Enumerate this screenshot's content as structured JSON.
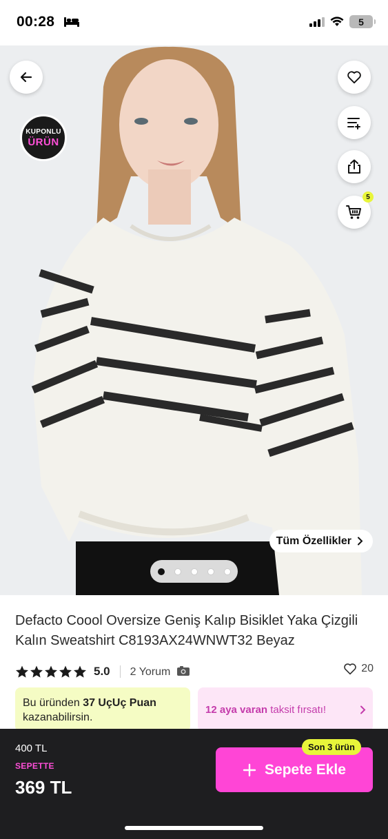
{
  "status_bar": {
    "time": "00:28",
    "battery": "5"
  },
  "hero": {
    "coupon_top": "KUPONLU",
    "coupon_bottom": "ÜRÜN",
    "cart_count": "5",
    "all_features_label": "Tüm Özellikler",
    "image_count": 5,
    "active_image": 1
  },
  "product": {
    "title": "Defacto Coool Oversize Geniş Kalıp Bisiklet Yaka Çizgili Kalın Sweatshirt C8193AX24WNWT32 Beyaz",
    "rating": "5.0",
    "stars": 5,
    "reviews_label": "2 Yorum",
    "favorites": "20"
  },
  "promo": {
    "points_prefix": "Bu üründen ",
    "points_bold": "37 UçUç Puan",
    "points_suffix": "kazanabilirsin.",
    "installment_bold": "12 aya varan",
    "installment_text": " taksit fırsatı!"
  },
  "bottom": {
    "old_price": "400 TL",
    "basket_label": "SEPETTE",
    "new_price": "369 TL",
    "add_label": "Sepete Ekle",
    "stock_label": "Son 3 ürün"
  },
  "colors": {
    "accent_pink": "#ff45d6",
    "accent_yellow": "#e8f53a",
    "bar_dark": "#1e1e20"
  }
}
